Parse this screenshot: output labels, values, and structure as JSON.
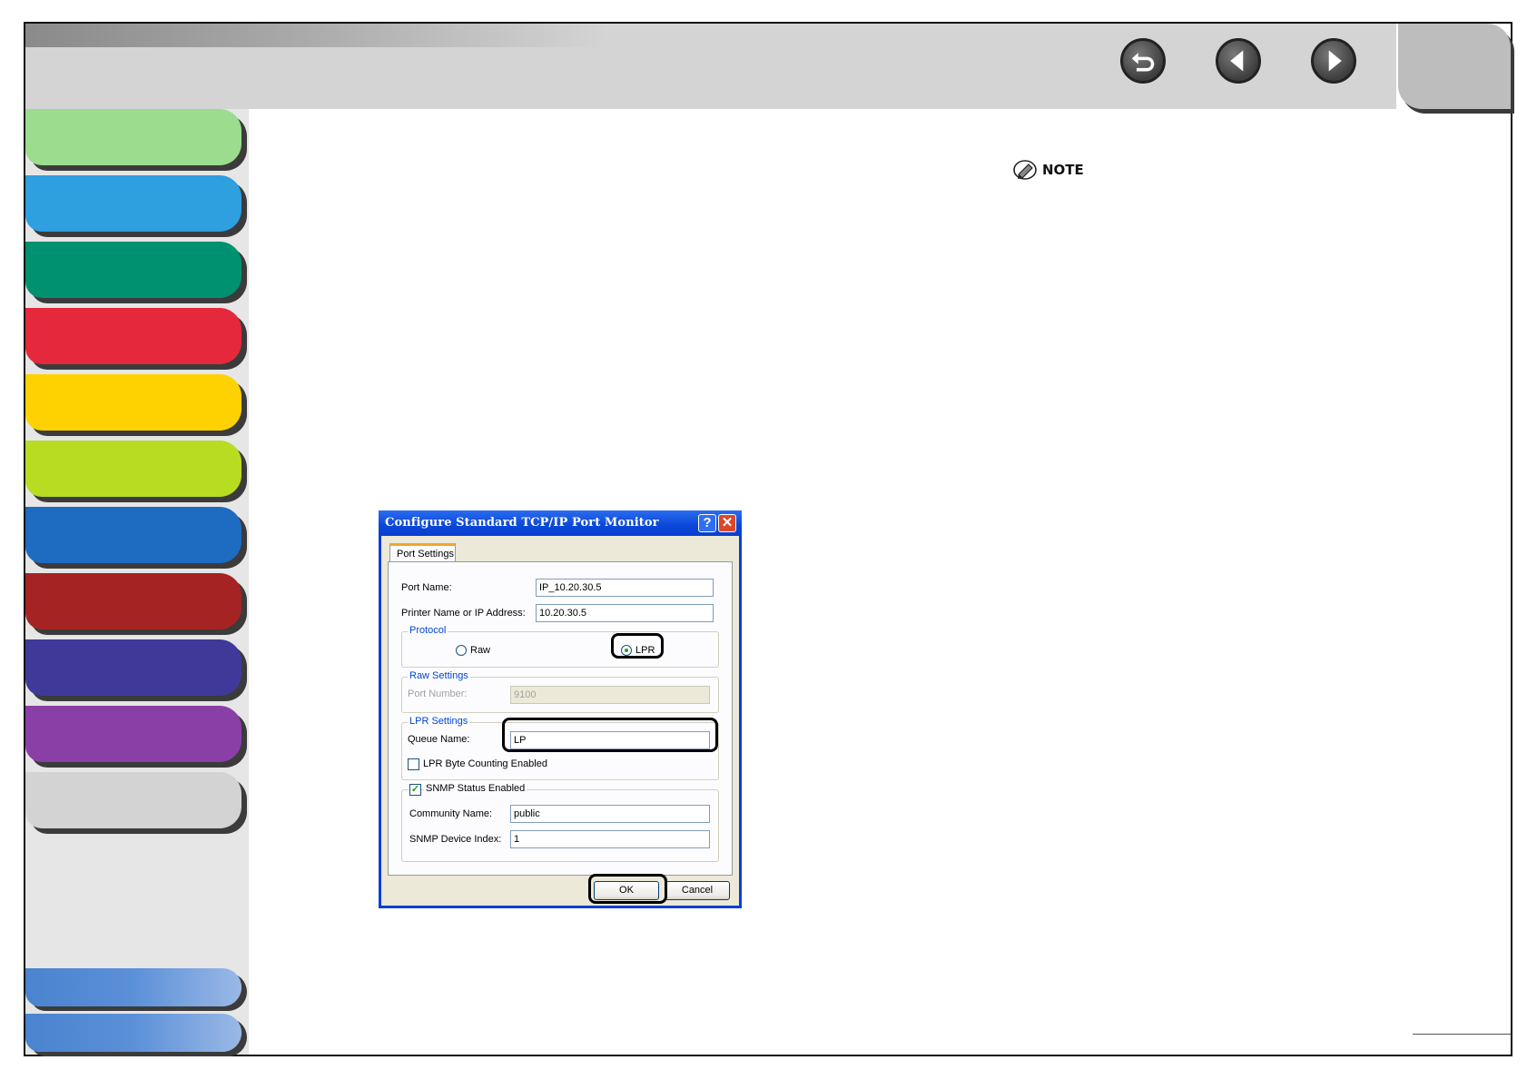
{
  "colors": {
    "sidebar_tabs": [
      "#9bdc8e",
      "#2e9fdf",
      "#009170",
      "#e5283c",
      "#fdd200",
      "#b7dc22",
      "#1e6bc2",
      "#a52423",
      "#3f3a9a",
      "#8a3fa6",
      "#d3d3d3"
    ],
    "bottom_tabs": "#5b90d8",
    "header": "#d4d4d4",
    "dialog_titlebar": "#0a46d8"
  },
  "header": {
    "back_icon": "return-arrow-icon",
    "prev_icon": "left-arrow-icon",
    "next_icon": "right-arrow-icon"
  },
  "note": {
    "label": "NOTE",
    "icon": "pencil-icon"
  },
  "dialog": {
    "title": "Configure Standard TCP/IP Port Monitor",
    "tab_label": "Port Settings",
    "port_name_label": "Port Name:",
    "port_name_value": "IP_10.20.30.5",
    "printer_name_label": "Printer Name or IP Address:",
    "printer_name_value": "10.20.30.5",
    "protocol": {
      "legend": "Protocol",
      "raw_label": "Raw",
      "lpr_label": "LPR",
      "selected": "LPR"
    },
    "raw_settings": {
      "legend": "Raw Settings",
      "port_number_label": "Port Number:",
      "port_number_value": "9100"
    },
    "lpr_settings": {
      "legend": "LPR Settings",
      "queue_name_label": "Queue Name:",
      "queue_name_value": "LP",
      "byte_counting_label": "LPR Byte Counting Enabled",
      "byte_counting_checked": false
    },
    "snmp": {
      "label": "SNMP Status Enabled",
      "checked": true,
      "community_label": "Community Name:",
      "community_value": "public",
      "device_index_label": "SNMP Device Index:",
      "device_index_value": "1"
    },
    "ok_label": "OK",
    "cancel_label": "Cancel"
  }
}
